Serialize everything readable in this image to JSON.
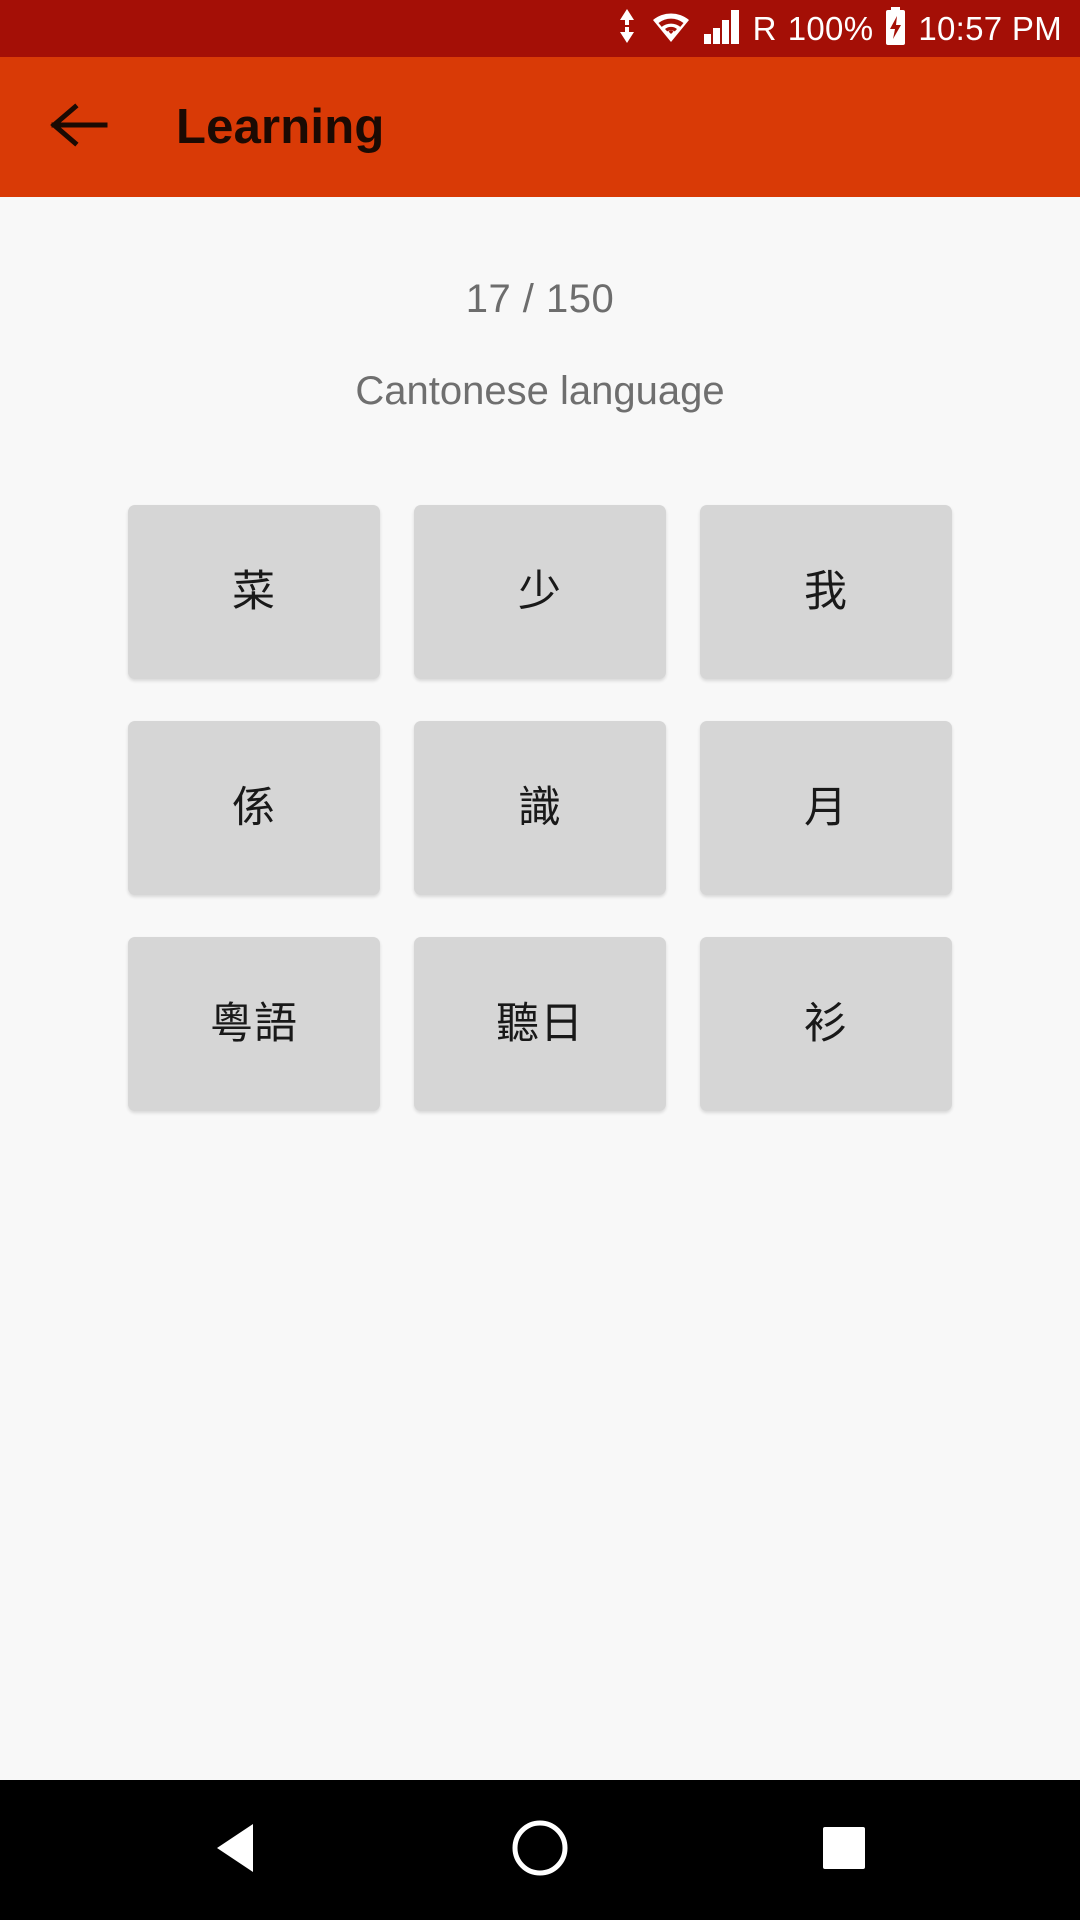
{
  "status_bar": {
    "background_color": "#a40f06",
    "data_transfer_icon": "data-transfer-arrows-icon",
    "wifi_icon": "wifi-icon",
    "signal_icon": "cellular-signal-icon",
    "roaming_label": "R",
    "battery_percent": "100%",
    "battery_icon": "battery-charging-icon",
    "clock": "10:57 PM"
  },
  "app_bar": {
    "background_color": "#d93a06",
    "back_icon": "arrow-left-icon",
    "title": "Learning"
  },
  "content": {
    "background_color": "#f8f8f8",
    "progress_counter": "17 / 150",
    "current_index": 17,
    "total_count": 150,
    "subtitle": "Cantonese language",
    "tile_color": "#d6d6d6",
    "tiles": [
      {
        "label": "菜"
      },
      {
        "label": "少"
      },
      {
        "label": "我"
      },
      {
        "label": "係"
      },
      {
        "label": "識"
      },
      {
        "label": "月"
      },
      {
        "label": "粵語"
      },
      {
        "label": "聽日"
      },
      {
        "label": "衫"
      }
    ]
  },
  "nav_bar": {
    "background_color": "#000000",
    "back_icon": "triangle-back-icon",
    "home_icon": "circle-home-icon",
    "recents_icon": "square-recents-icon"
  }
}
